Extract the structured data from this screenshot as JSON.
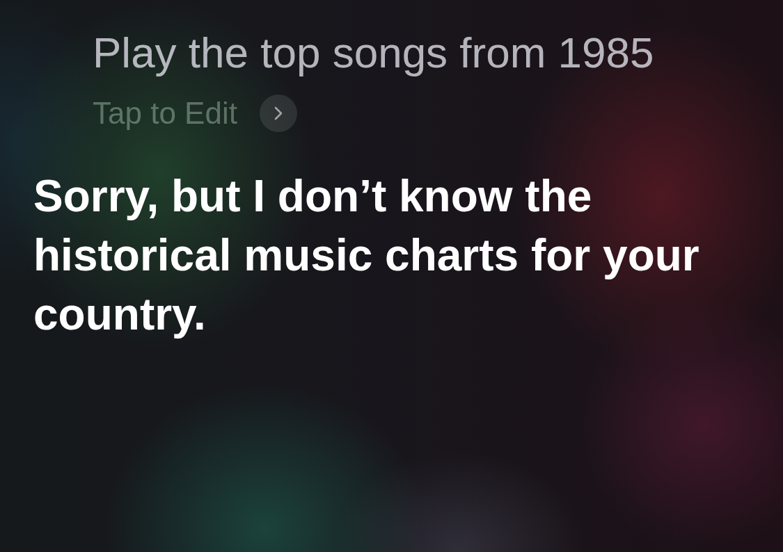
{
  "query": {
    "text": "Play the top songs from 1985",
    "edit_hint": "Tap to Edit"
  },
  "response": {
    "text": "Sorry, but I don’t know the historical music charts for your country."
  }
}
